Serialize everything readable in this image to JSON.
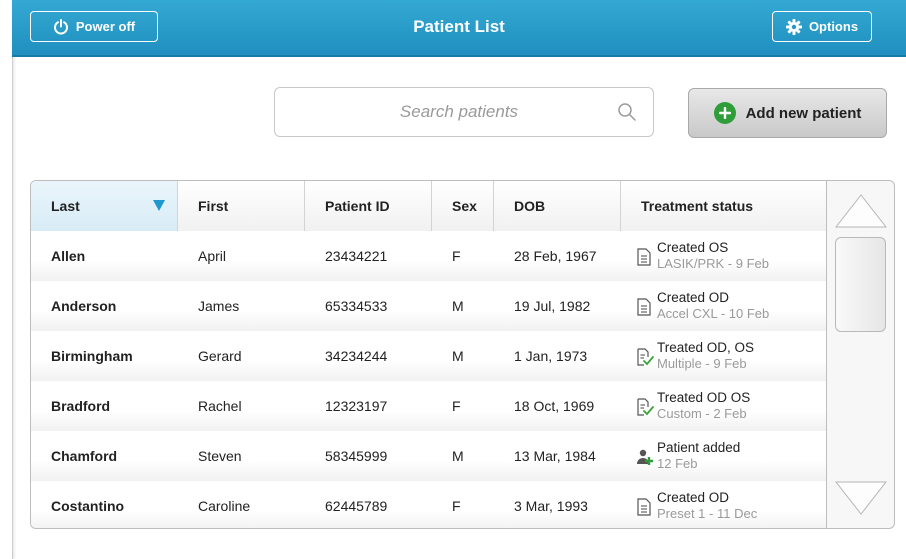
{
  "header": {
    "title": "Patient List",
    "power_label": "Power off",
    "options_label": "Options",
    "color": "#279dcb"
  },
  "search": {
    "placeholder": "Search patients",
    "value": ""
  },
  "add_button": {
    "label": "Add new patient",
    "accent": "#2f9e3a"
  },
  "table": {
    "columns": [
      "Last",
      "First",
      "Patient ID",
      "Sex",
      "DOB",
      "Treatment status"
    ],
    "sorted_column": "Last",
    "sort_direction": "descending",
    "rows": [
      {
        "last": "Allen",
        "first": "April",
        "id": "23434221",
        "sex": "F",
        "dob": "28 Feb, 1967",
        "status": "Created OS",
        "detail": "LASIK/PRK - 9 Feb",
        "icon": "document-icon"
      },
      {
        "last": "Anderson",
        "first": "James",
        "id": "65334533",
        "sex": "M",
        "dob": "19 Jul, 1982",
        "status": "Created OD",
        "detail": "Accel CXL - 10 Feb",
        "icon": "document-icon"
      },
      {
        "last": "Birmingham",
        "first": "Gerard",
        "id": "34234244",
        "sex": "M",
        "dob": "1 Jan, 1973",
        "status": "Treated OD, OS",
        "detail": "Multiple - 9 Feb",
        "icon": "document-check-icon"
      },
      {
        "last": "Bradford",
        "first": "Rachel",
        "id": "12323197",
        "sex": "F",
        "dob": "18 Oct, 1969",
        "status": "Treated OD OS",
        "detail": "Custom - 2 Feb",
        "icon": "document-check-icon"
      },
      {
        "last": "Chamford",
        "first": "Steven",
        "id": "58345999",
        "sex": "M",
        "dob": "13 Mar, 1984",
        "status": "Patient added",
        "detail": "12 Feb",
        "icon": "person-add-icon"
      },
      {
        "last": "Costantino",
        "first": "Caroline",
        "id": "62445789",
        "sex": "F",
        "dob": "3 Mar, 1993",
        "status": "Created OD",
        "detail": "Preset 1 - 11 Dec",
        "icon": "document-icon"
      }
    ]
  },
  "scrollbar": {
    "up_icon": "scroll-up-arrow-icon",
    "down_icon": "scroll-down-arrow-icon",
    "position": 0.0
  }
}
